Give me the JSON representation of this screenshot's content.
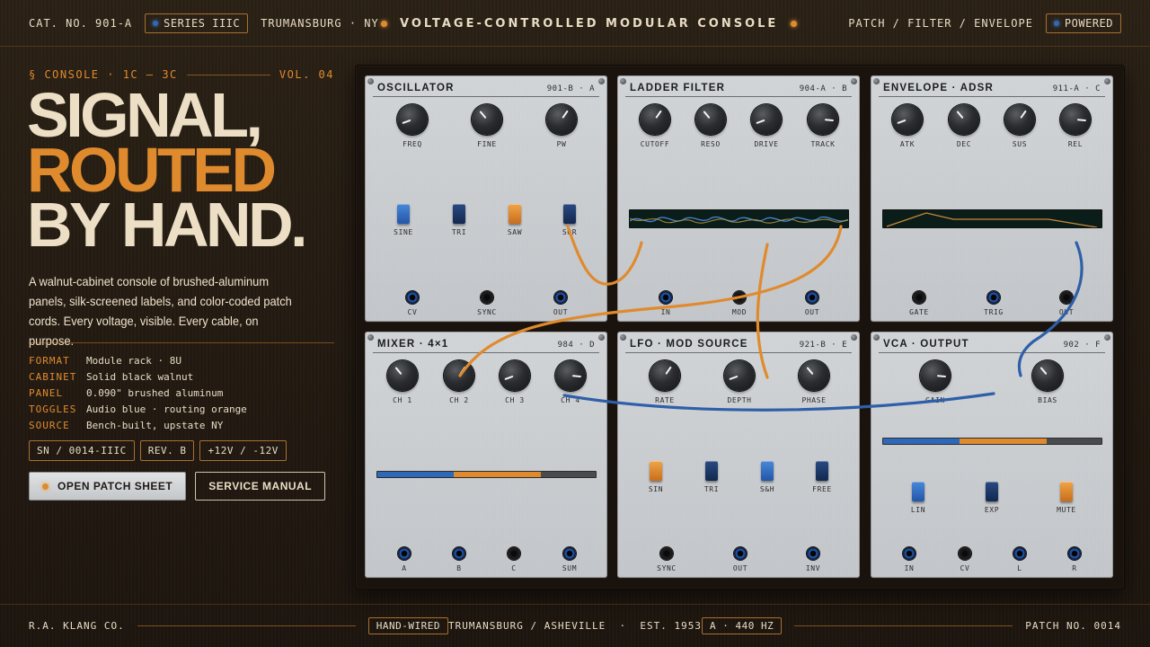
{
  "topbar": {
    "cat_no": "CAT. NO. 901-A",
    "series": "SERIES IIIC",
    "location": "TRUMANSBURG · NY",
    "title": "VOLTAGE-CONTROLLED MODULAR CONSOLE",
    "nav": "PATCH / FILTER / ENVELOPE",
    "powered": "POWERED"
  },
  "hero": {
    "kicker": "§ CONSOLE · 1C — 3C",
    "volume": "VOL. 04",
    "headline_1": "SIGNAL,",
    "headline_2": "ROUTED",
    "headline_3": "BY HAND.",
    "lede": "A walnut-cabinet console of brushed-aluminum panels, silk-screened labels, and color-coded patch cords. Every voltage, visible. Every cable, on purpose.",
    "specs": [
      {
        "key": "FORMAT",
        "value": "Module rack · 8U"
      },
      {
        "key": "CABINET",
        "value": "Solid black walnut"
      },
      {
        "key": "PANEL",
        "value": "0.090\" brushed aluminum"
      },
      {
        "key": "TOGGLES",
        "value": "Audio blue · routing orange"
      },
      {
        "key": "SOURCE",
        "value": "Bench-built, upstate NY"
      }
    ],
    "tags": [
      "SN / 0014-IIIC",
      "REV. B",
      "+12V / -12V"
    ],
    "primary_button": "OPEN PATCH SHEET",
    "secondary_button": "SERVICE MANUAL"
  },
  "modules": [
    {
      "title": "OSCILLATOR",
      "code": "901-B · A",
      "knobs": [
        {
          "label": "FREQ",
          "angle": -110
        },
        {
          "label": "FINE",
          "angle": -40
        },
        {
          "label": "PW",
          "angle": 35
        }
      ],
      "toggles": [
        {
          "label": "SINE",
          "color": "blue"
        },
        {
          "label": "TRI",
          "color": "navy"
        },
        {
          "label": "SAW",
          "color": "orange"
        },
        {
          "label": "SQR",
          "color": "navy"
        }
      ],
      "jacks": [
        {
          "label": "CV",
          "style": "blue"
        },
        {
          "label": "SYNC",
          "style": "black"
        },
        {
          "label": "OUT",
          "style": "blue"
        }
      ]
    },
    {
      "title": "LADDER FILTER",
      "code": "904-A · B",
      "knobs": [
        {
          "label": "CUTOFF",
          "angle": 35
        },
        {
          "label": "RESO",
          "angle": -40
        },
        {
          "label": "DRIVE",
          "angle": -110
        },
        {
          "label": "TRACK",
          "angle": 95
        }
      ],
      "jacks": [
        {
          "label": "IN",
          "style": "blue"
        },
        {
          "label": "MOD",
          "style": "black"
        },
        {
          "label": "OUT",
          "style": "blue"
        }
      ]
    },
    {
      "title": "ENVELOPE · ADSR",
      "code": "911-A · C",
      "knobs": [
        {
          "label": "ATK",
          "angle": -110
        },
        {
          "label": "DEC",
          "angle": -40
        },
        {
          "label": "SUS",
          "angle": 35
        },
        {
          "label": "REL",
          "angle": 95
        }
      ],
      "jacks": [
        {
          "label": "GATE",
          "style": "black"
        },
        {
          "label": "TRIG",
          "style": "blue"
        },
        {
          "label": "OUT",
          "style": "black"
        }
      ]
    },
    {
      "title": "MIXER · 4×1",
      "code": "984 · D",
      "knobs": [
        {
          "label": "CH 1",
          "angle": -40
        },
        {
          "label": "CH 2",
          "angle": 35
        },
        {
          "label": "CH 3",
          "angle": -110
        },
        {
          "label": "CH 4",
          "angle": 95
        }
      ],
      "meter": {
        "blue": 0.35,
        "orange": 0.4
      },
      "jacks": [
        {
          "label": "A",
          "style": "blue"
        },
        {
          "label": "B",
          "style": "blue"
        },
        {
          "label": "C",
          "style": "black"
        },
        {
          "label": "SUM",
          "style": "blue"
        }
      ]
    },
    {
      "title": "LFO · MOD SOURCE",
      "code": "921-B · E",
      "knobs": [
        {
          "label": "RATE",
          "angle": 35
        },
        {
          "label": "DEPTH",
          "angle": -110
        },
        {
          "label": "PHASE",
          "angle": -40
        }
      ],
      "toggles": [
        {
          "label": "SIN",
          "color": "orange"
        },
        {
          "label": "TRI",
          "color": "navy"
        },
        {
          "label": "S&H",
          "color": "blue"
        },
        {
          "label": "FREE",
          "color": "navy"
        }
      ],
      "jacks": [
        {
          "label": "SYNC",
          "style": "black"
        },
        {
          "label": "OUT",
          "style": "blue"
        },
        {
          "label": "INV",
          "style": "blue"
        }
      ]
    },
    {
      "title": "VCA · OUTPUT",
      "code": "902 · F",
      "knobs": [
        {
          "label": "GAIN",
          "angle": 95
        },
        {
          "label": "BIAS",
          "angle": -40
        }
      ],
      "meter": {
        "blue": 0.35,
        "orange": 0.4
      },
      "toggles": [
        {
          "label": "LIN",
          "color": "blue"
        },
        {
          "label": "EXP",
          "color": "navy"
        },
        {
          "label": "MUTE",
          "color": "orange"
        }
      ],
      "jacks": [
        {
          "label": "IN",
          "style": "blue"
        },
        {
          "label": "CV",
          "style": "black"
        },
        {
          "label": "L",
          "style": "blue"
        },
        {
          "label": "R",
          "style": "blue"
        }
      ]
    }
  ],
  "footer": {
    "maker": "R.A. KLANG CO.",
    "badge": "HAND-WIRED",
    "middle": "TRUMANSBURG / ASHEVILLE  ·  EST. 1953",
    "tuning": "A · 440 HZ",
    "patch_no": "PATCH NO. 0014"
  },
  "colors": {
    "accent_orange": "#e08a2e",
    "accent_blue": "#2e68b8",
    "walnut": "#241b12",
    "panel": "#cfd2d5"
  }
}
